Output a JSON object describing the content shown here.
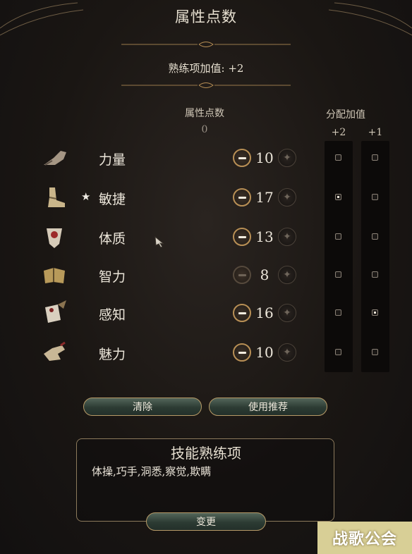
{
  "header": {
    "title": "属性点数",
    "proficiency_bonus": "熟练项加值: +2"
  },
  "points": {
    "label": "属性点数",
    "remaining": "0"
  },
  "allocation": {
    "label": "分配加值",
    "plus2_label": "+2",
    "plus1_label": "+1"
  },
  "abilities": [
    {
      "name": "力量",
      "score": "10",
      "icon": "strength-arm-icon",
      "starred": false,
      "plus2": false,
      "plus1": false,
      "minus_enabled": true
    },
    {
      "name": "敏捷",
      "score": "17",
      "icon": "dexterity-boot-icon",
      "starred": true,
      "plus2": true,
      "plus1": false,
      "minus_enabled": true
    },
    {
      "name": "体质",
      "score": "13",
      "icon": "constitution-heart-icon",
      "starred": false,
      "plus2": false,
      "plus1": false,
      "minus_enabled": true
    },
    {
      "name": "智力",
      "score": "8",
      "icon": "intelligence-book-icon",
      "starred": false,
      "plus2": false,
      "plus1": false,
      "minus_enabled": false
    },
    {
      "name": "感知",
      "score": "16",
      "icon": "wisdom-scroll-icon",
      "starred": false,
      "plus2": false,
      "plus1": true,
      "minus_enabled": true
    },
    {
      "name": "魅力",
      "score": "10",
      "icon": "charisma-hand-icon",
      "starred": false,
      "plus2": false,
      "plus1": false,
      "minus_enabled": true
    }
  ],
  "star_glyph": "★",
  "buttons": {
    "clear": "清除",
    "use_recommended": "使用推荐",
    "change": "变更"
  },
  "skills_panel": {
    "title": "技能熟练项",
    "skills": "体操,巧手,洞悉,察觉,欺瞒"
  },
  "watermark": "战歌公会",
  "colors": {
    "gold_border": "#b88f55",
    "button_green": "#2c3b33",
    "text": "#ece6da"
  }
}
